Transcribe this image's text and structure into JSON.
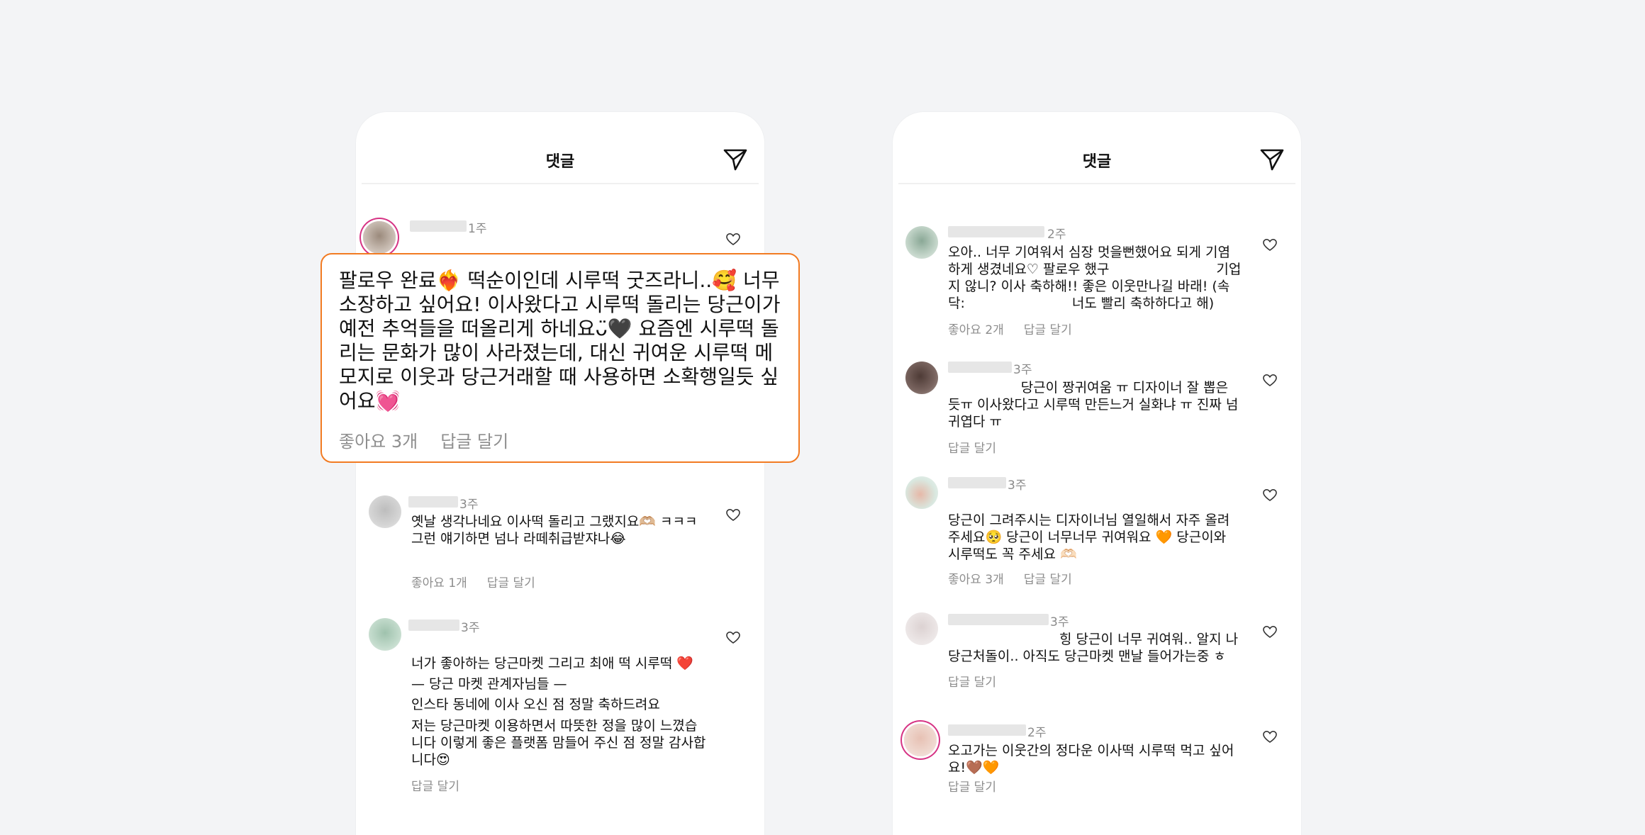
{
  "phones": [
    {
      "title": "댓글",
      "icon": "send-icon"
    },
    {
      "title": "댓글",
      "icon": "send-icon"
    }
  ],
  "highlight": {
    "text": "팔로우 완료❤️‍🔥 떡순이인데 시루떡 굿즈라니..🥰 너무 소장하고 싶어요! 이사왔다고 시루떡 돌리는 당근이가 예전 추억들을 떠올리게 하네요ᴗ̈🖤 요즘엔 시루떡 돌리는 문화가 많이 사라졌는데, 대신 귀여운 시루떡 메모지로 이웃과 당근거래할 때 사용하면 소확행일듯 싶어요💓",
    "likes": "좋아요 3개",
    "reply": "답글 달기"
  },
  "left_comments": [
    {
      "time": "1주"
    },
    {
      "time": "3주",
      "text": "옛날 생각나네요 이사떡 돌리고 그랬지요🫶🏼 ㅋㅋㅋ                                      그런 얘기하면 넘나 라떼취급받쟈나😂",
      "likes": "좋아요 1개",
      "reply": "답글 달기"
    },
    {
      "time": "3주",
      "lines": [
        "너가 좋아하는 당근마켓 그리고 최애 떡 시루떡 ❤️",
        "— 당근 마켓 관계자님들 —",
        "인스타 동네에 이사 오신 점 정말 축하드려요",
        "저는 당근마켓 이용하면서 따뜻한 정을 많이 느꼈습니다 이렇게 좋은 플랫폼 맘들어 주신 점 정말 감사합니다😍"
      ],
      "reply": "답글 달기"
    }
  ],
  "right_comments": [
    {
      "time": "2주",
      "text": "오아.. 너무 기여워서 심장 멋을뻔했어요 되게 기염하게 생겼네요♡ 팔로우 했구                         기업지 않니? 이사 축하해!! 좋은 이웃만나길 바래! (속닥:                         너도 빨리 축하하다고 해)",
      "likes": "좋아요 2개",
      "reply": "답글 달기"
    },
    {
      "time": "3주",
      "text": "                 당근이 짱귀여움 ㅠ 디자이너 잘 뽑은 듯ㅠ 이사왔다고 시루떡 만든느거 실화냐 ㅠ 진짜 넘 귀엽다 ㅠ",
      "reply": "답글 달기"
    },
    {
      "time": "3주",
      "text": "                                                                    당근이 그려주시는 디자이너님 열일해서 자주 올려주세요🥺 당근이 너무너무 귀여워요 🧡 당근이와 시루떡도 꼭 주세요 🫶🏻",
      "likes": "좋아요 3개",
      "reply": "답글 달기"
    },
    {
      "time": "3주",
      "text": "                          힝 당근이 너무 귀여워.. 알지 나 당근처돌이.. 아직도 당근마켓 맨날 들어가는중 ㅎ",
      "reply": "답글 달기"
    },
    {
      "time": "2주",
      "text": "오고가는 이웃간의 정다운 이사떡 시루떡 먹고 싶어요!🤎🧡",
      "reply": "답글 달기"
    }
  ],
  "colors": {
    "highlight_border": "#f27b22",
    "avatar_ring": "#d63384"
  }
}
